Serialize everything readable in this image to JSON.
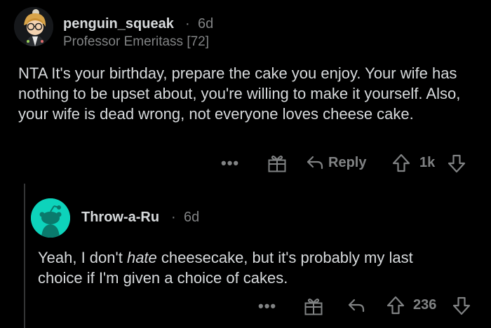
{
  "comment": {
    "username": "penguin_squeak",
    "separator": "·",
    "age": "6d",
    "flair": "Professor Emeritass [72]",
    "body": "NTA It's your birthday, prepare the cake you enjoy. Your wife has nothing to be upset about, you're willing to make it yourself. Also, your wife is dead wrong, not everyone loves cheese cake.",
    "more_label": "•••",
    "reply_label": "Reply",
    "vote_count": "1k"
  },
  "reply": {
    "username": "Throw-a-Ru",
    "separator": "·",
    "age": "6d",
    "body_before": "Yeah, I don't ",
    "body_emphasis": "hate",
    "body_after": " cheesecake, but it's probably my last choice if I'm given a choice of cakes.",
    "more_label": "•••",
    "vote_count": "236"
  },
  "icons": {
    "gift": "gift-icon",
    "reply": "reply-arrow-icon",
    "upvote": "upvote-arrow-icon",
    "downvote": "downvote-arrow-icon",
    "default_avatar": "snoo-avatar-icon"
  },
  "colors": {
    "background": "#000000",
    "text": "#d7dadc",
    "muted": "#818384",
    "avatar_teal": "#0dd3bb"
  }
}
